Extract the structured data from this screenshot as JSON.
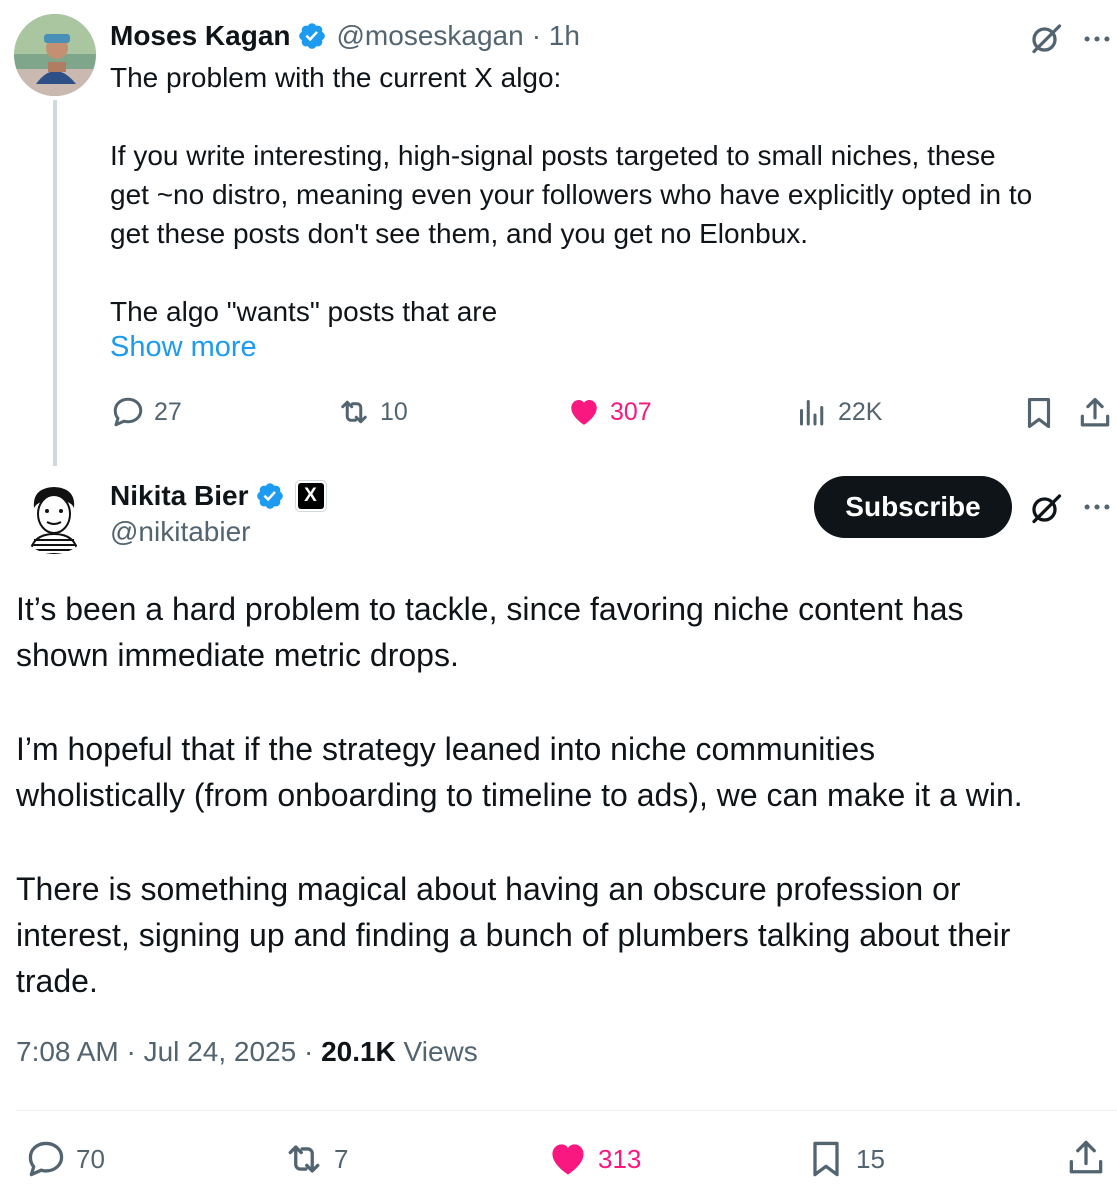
{
  "colors": {
    "text": "#0f1419",
    "secondary": "#536471",
    "link": "#1d9bf0",
    "like": "#f91880",
    "verified": "#1d9bf0",
    "button_bg": "#0f1419"
  },
  "parent_tweet": {
    "author_name": "Moses Kagan",
    "handle": "@moseskagan",
    "time": "· 1h",
    "text_lines": [
      "The problem with the current X algo:",
      "",
      "If you write interesting, high-signal posts targeted to small niches, these",
      "get ~no distro, meaning even your followers who have explicitly opted in to",
      "get these posts don't see them, and you get no Elonbux.",
      "",
      "The algo \"wants\" posts that are"
    ],
    "show_more": "Show more",
    "actions": {
      "replies": "27",
      "reposts": "10",
      "likes": "307",
      "views": "22K"
    }
  },
  "main_tweet": {
    "author_name": "Nikita Bier",
    "handle": "@nikitabier",
    "affiliate_badge": "X",
    "subscribe_label": "Subscribe",
    "text_paragraphs": [
      [
        "It’s been a hard problem to tackle, since favoring niche content has",
        "shown immediate metric drops."
      ],
      [
        "I’m hopeful that if the strategy leaned into niche communities",
        "wholistically (from onboarding to timeline to ads), we can make it a win."
      ],
      [
        "There is something magical about having an obscure profession or",
        "interest, signing up and finding a bunch of plumbers talking about their",
        "trade."
      ]
    ],
    "timestamp": "7:08 AM · Jul 24, 2025 · ",
    "views_count": "20.1K",
    "views_label": " Views",
    "actions": {
      "replies": "70",
      "reposts": "7",
      "likes": "313",
      "bookmarks": "15"
    }
  }
}
